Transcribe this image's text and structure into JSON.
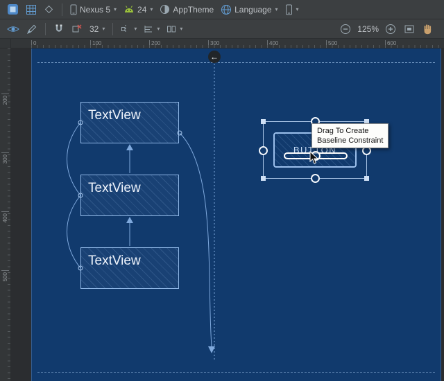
{
  "icons": {
    "caret": "▾",
    "back_arrow": "←"
  },
  "toolbar": {
    "device": "Nexus 5",
    "api_level": "24",
    "theme": "AppTheme",
    "language": "Language",
    "default_margin": "32",
    "zoom_level": "125%"
  },
  "rulers": {
    "h": [
      "0",
      "100",
      "200",
      "300",
      "400",
      "500",
      "600"
    ],
    "v": [
      "200",
      "300",
      "400",
      "500"
    ]
  },
  "canvas": {
    "textviews": [
      {
        "label": "TextView"
      },
      {
        "label": "TextView"
      },
      {
        "label": "TextView"
      }
    ],
    "button": {
      "label": "BUTTON"
    },
    "tooltip": {
      "line1": "Drag To Create",
      "line2": "Baseline Constraint"
    }
  },
  "colors": {
    "blueprint_bg": "#113a6d",
    "blueprint_line": "#7fa9dd",
    "toolbar_bg": "#3c3f41",
    "selection_handle": "#cfe0f5",
    "tooltip_bg": "#fdfdfb",
    "api_icon_green": "#9bc13c",
    "hand_icon_tan": "#c9a06d"
  }
}
